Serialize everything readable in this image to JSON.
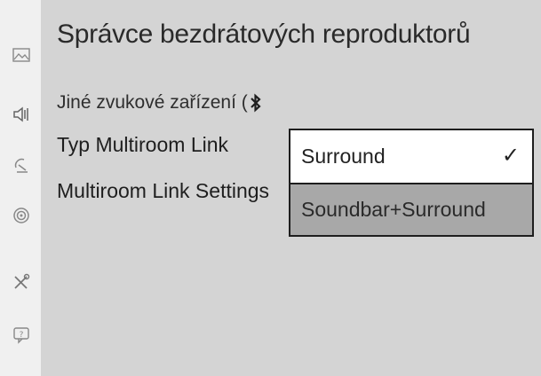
{
  "sidebar": {
    "icons": [
      "picture-icon",
      "sound-icon",
      "broadcast-icon",
      "network-icon",
      "tools-icon",
      "support-icon"
    ]
  },
  "header": {
    "title": "Správce bezdrátových reproduktorů"
  },
  "menu": {
    "other_device": "Jiné zvukové zařízení (",
    "multiroom_type": "Typ Multiroom Link",
    "multiroom_settings": "Multiroom Link Settings"
  },
  "dropdown": {
    "options": [
      {
        "label": "Surround",
        "selected": true,
        "check": "✓"
      },
      {
        "label": "Soundbar+Surround",
        "selected": false
      }
    ]
  },
  "colors": {
    "panel": "#d4d4d4",
    "sidebar": "#f0f0f0",
    "selected_option": "#ffffff",
    "unselected_option": "#a8a8a8"
  }
}
